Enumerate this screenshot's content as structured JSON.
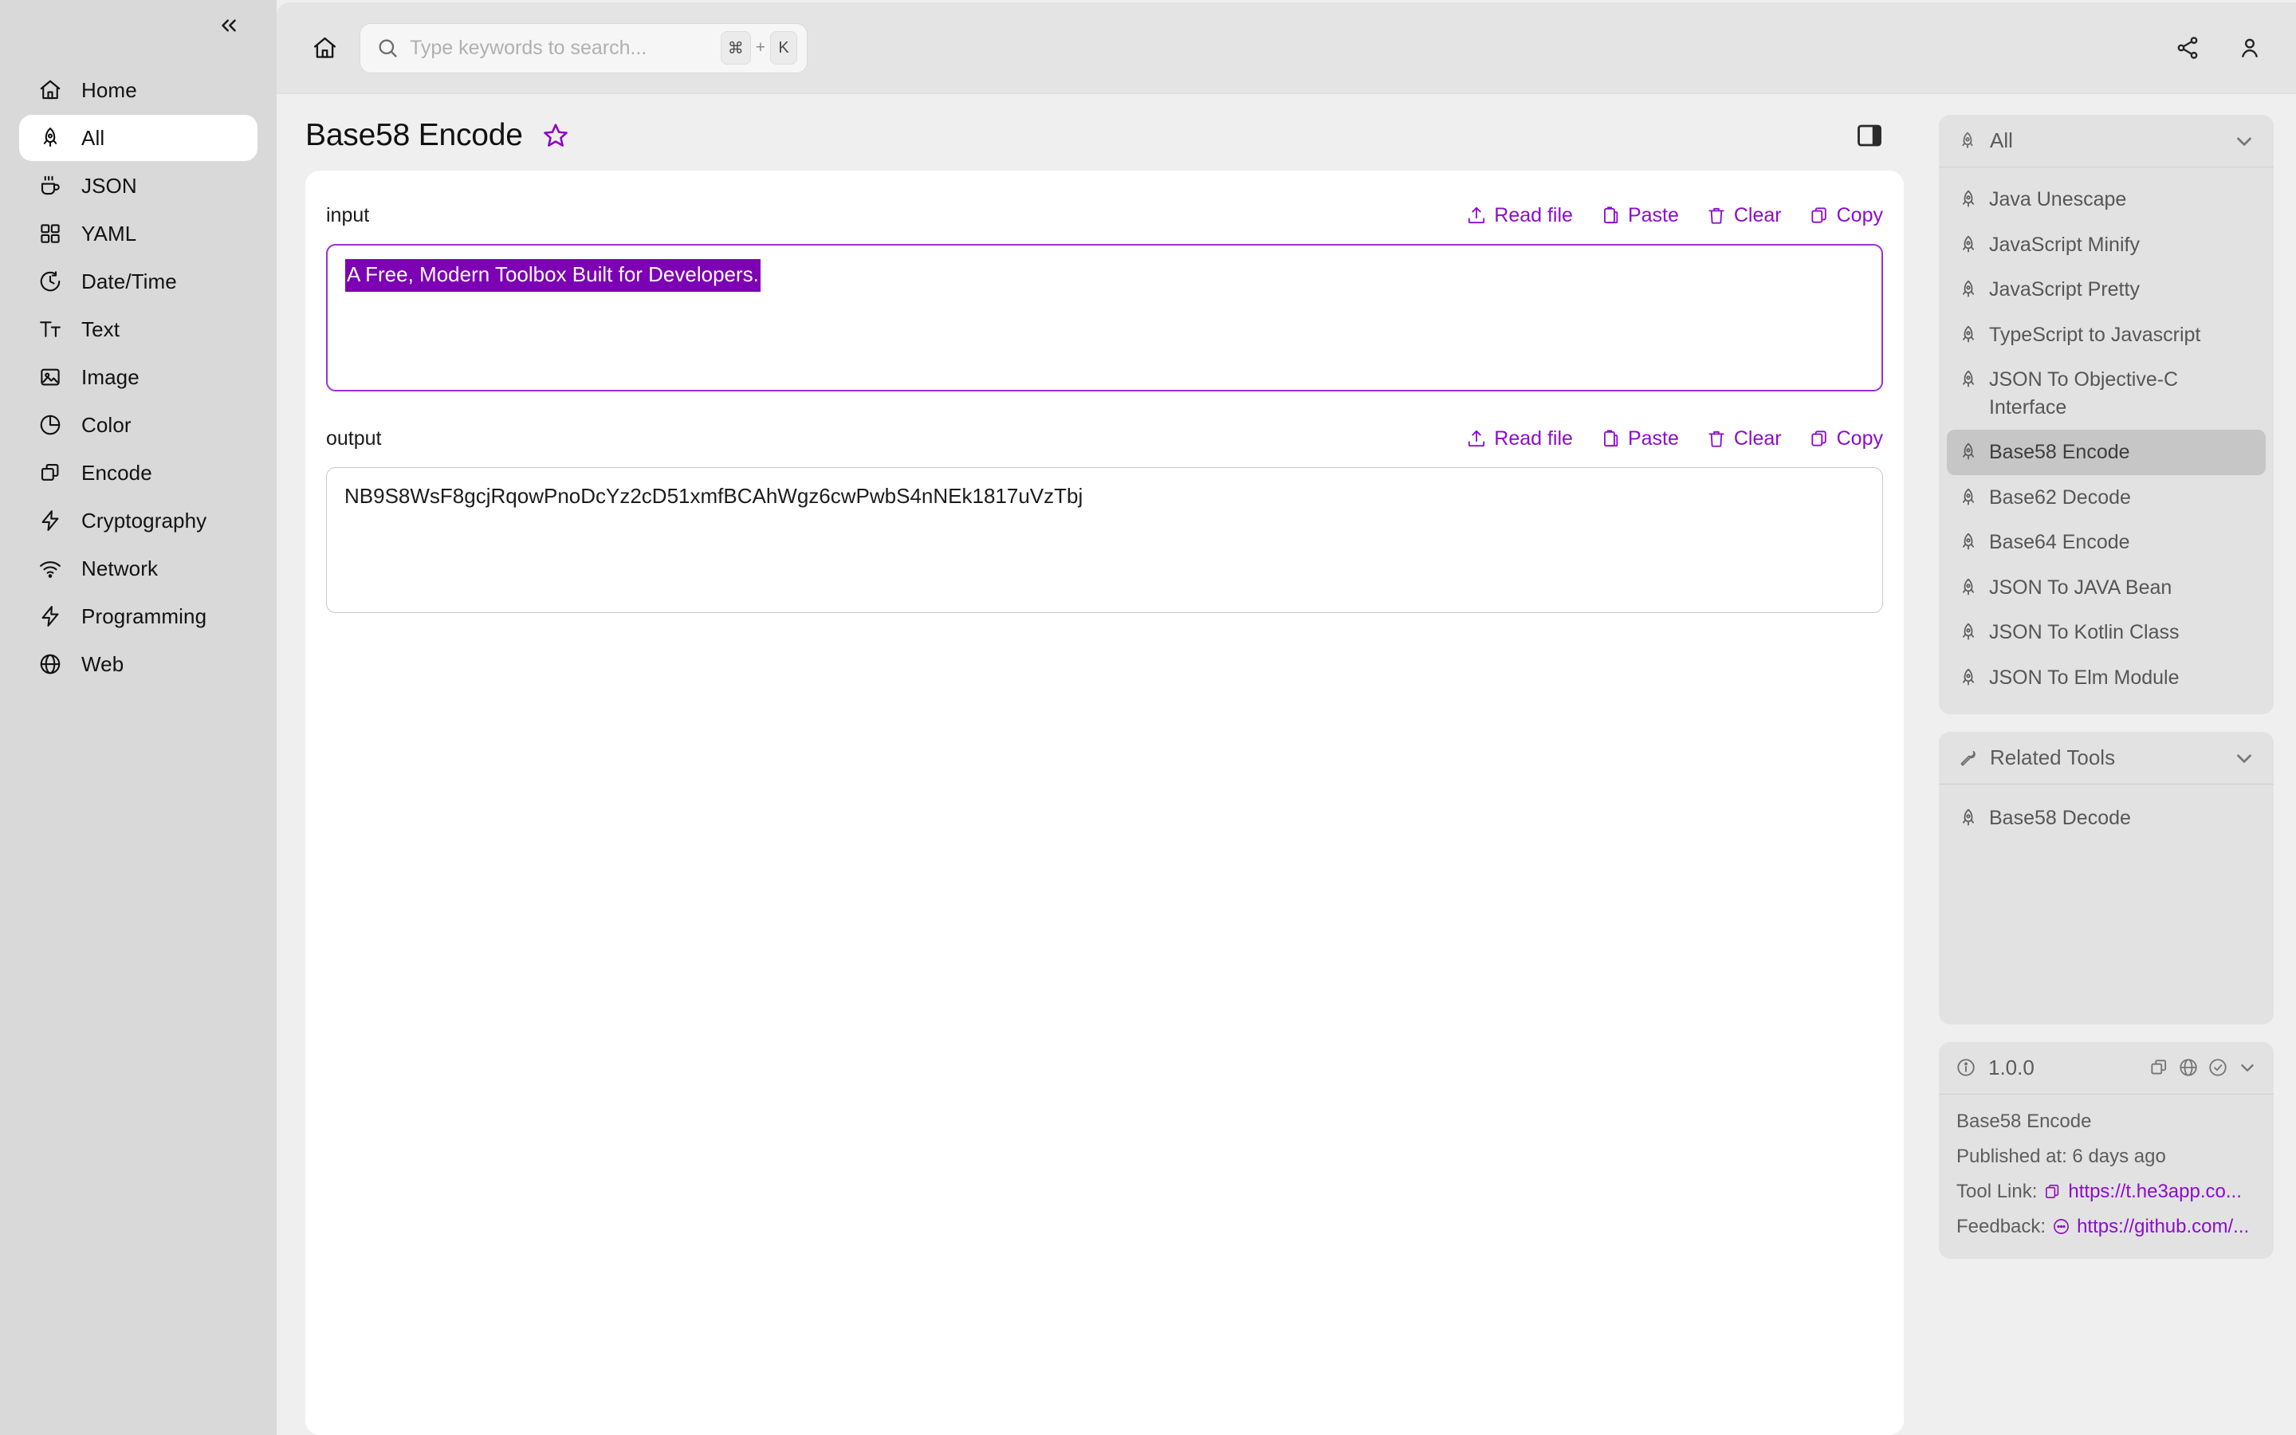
{
  "sidebar": {
    "collapse_icon": "chevrons-left-icon",
    "items": [
      {
        "label": "Home",
        "icon": "home-icon",
        "active": false
      },
      {
        "label": "All",
        "icon": "rocket-icon",
        "active": true
      },
      {
        "label": "JSON",
        "icon": "coffee-icon",
        "active": false
      },
      {
        "label": "YAML",
        "icon": "grid-icon",
        "active": false
      },
      {
        "label": "Date/Time",
        "icon": "clock-icon",
        "active": false
      },
      {
        "label": "Text",
        "icon": "text-icon",
        "active": false
      },
      {
        "label": "Image",
        "icon": "image-icon",
        "active": false
      },
      {
        "label": "Color",
        "icon": "pie-chart-icon",
        "active": false
      },
      {
        "label": "Encode",
        "icon": "copy-layers-icon",
        "active": false
      },
      {
        "label": "Cryptography",
        "icon": "bolt-icon",
        "active": false
      },
      {
        "label": "Network",
        "icon": "wifi-icon",
        "active": false
      },
      {
        "label": "Programming",
        "icon": "bolt-icon",
        "active": false
      },
      {
        "label": "Web",
        "icon": "globe-icon",
        "active": false
      }
    ]
  },
  "topbar": {
    "home_icon": "home-icon",
    "search": {
      "placeholder": "Type keywords to search...",
      "value": "",
      "icon": "search-icon",
      "shortcut_key": "⌘",
      "shortcut_plus": "+",
      "shortcut_letter": "K"
    },
    "share_icon": "share-icon",
    "account_icon": "user-icon"
  },
  "page": {
    "title": "Base58 Encode",
    "favorite_icon": "star-outline-icon",
    "panel_toggle_icon": "right-panel-toggle-icon"
  },
  "io_actions": [
    {
      "label": "Read file",
      "icon": "upload-icon"
    },
    {
      "label": "Paste",
      "icon": "clipboard-icon"
    },
    {
      "label": "Clear",
      "icon": "trash-icon"
    },
    {
      "label": "Copy",
      "icon": "copy-icon"
    }
  ],
  "input_panel": {
    "label": "input",
    "value": "A Free, Modern Toolbox Built for Developers.",
    "selected_text": "A Free, Modern Toolbox Built for Developers.",
    "selection_color": "#7d00b4"
  },
  "output_panel": {
    "label": "output",
    "value": "NB9S8WsF8gcjRqowPnoDcYz2cD51xmfBCAhWgz6cwPwbS4nNEk1817uVzTbj"
  },
  "rail": {
    "tools_card": {
      "title": "All",
      "icon": "rocket-icon",
      "chevron": "chevron-down-icon",
      "items": [
        {
          "label": "Java Unescape",
          "selected": false
        },
        {
          "label": "JavaScript Minify",
          "selected": false
        },
        {
          "label": "JavaScript Pretty",
          "selected": false
        },
        {
          "label": "TypeScript to Javascript",
          "selected": false
        },
        {
          "label": "JSON To Objective-C Interface",
          "selected": false
        },
        {
          "label": "Base58 Encode",
          "selected": true
        },
        {
          "label": "Base62 Decode",
          "selected": false
        },
        {
          "label": "Base64 Encode",
          "selected": false
        },
        {
          "label": "JSON To JAVA Bean",
          "selected": false
        },
        {
          "label": "JSON To Kotlin Class",
          "selected": false
        },
        {
          "label": "JSON To Elm Module",
          "selected": false
        }
      ]
    },
    "related_card": {
      "title": "Related Tools",
      "icon": "wrench-icon",
      "chevron": "chevron-down-icon",
      "items": [
        {
          "label": "Base58 Decode"
        }
      ]
    },
    "version_card": {
      "info_icon": "info-circle-icon",
      "version": "1.0.0",
      "header_icons": [
        "copy-layers-icon",
        "globe-icon",
        "check-circle-icon",
        "chevron-down-icon"
      ],
      "tool_name": "Base58 Encode",
      "published": "Published at: 6 days ago",
      "tool_link_label": "Tool Link:",
      "tool_link_url": "https://t.he3app.co...",
      "feedback_label": "Feedback:",
      "feedback_url": "https://github.com/...",
      "link_color": "#8c0dcc"
    }
  }
}
